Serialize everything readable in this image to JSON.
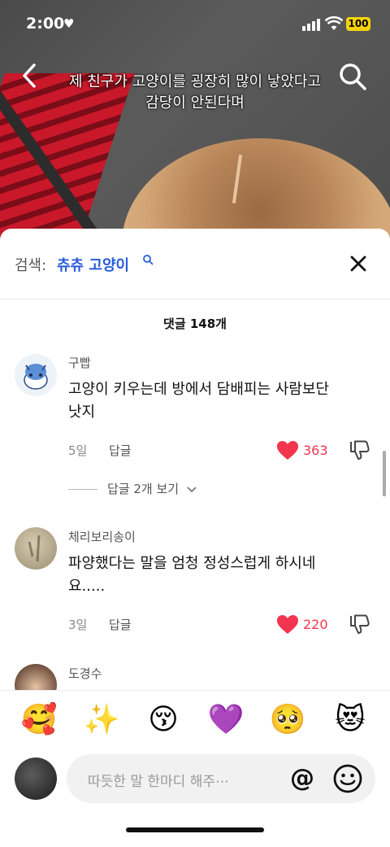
{
  "status": {
    "time": "2:00",
    "battery": "100"
  },
  "video": {
    "caption_line1": "제 친구가 고양이를 굉장히 많이 낳았다고",
    "caption_line2": "감당이 안된다며"
  },
  "search": {
    "prefix": "검색:",
    "term": "츄츄 고양이"
  },
  "comments_count": "댓글 148개",
  "comments": [
    {
      "user": "구빱",
      "text_line1": "고양이 키우는데 방에서 담배피는 사람보단",
      "text_line2": "낫지",
      "time": "5일",
      "reply_label": "답글",
      "likes": "363",
      "view_replies": "답글 2개 보기"
    },
    {
      "user": "체리보리송이",
      "text_line1": "파양했다는 말을 엄청 정성스럽게 하시네",
      "text_line2": "요.....",
      "time": "3일",
      "reply_label": "답글",
      "likes": "220"
    },
    {
      "user": "도경수"
    }
  ],
  "emoji_bar": [
    "🥰",
    "✨",
    "😚",
    "💜",
    "🥺",
    "😻"
  ],
  "composer": {
    "placeholder": "따듯한 말 한마디 해주⋯",
    "at_symbol": "@"
  },
  "icons": [
    "heart-icon",
    "signal-icon",
    "wifi-icon",
    "back-icon",
    "search-icon",
    "close-icon",
    "like-heart-icon",
    "dislike-icon",
    "chevron-down-icon",
    "emoji-icon"
  ],
  "colors": {
    "accent_blue": "#2a5bd7",
    "like_red": "#f2354e",
    "battery_yellow": "#f5d20a"
  }
}
